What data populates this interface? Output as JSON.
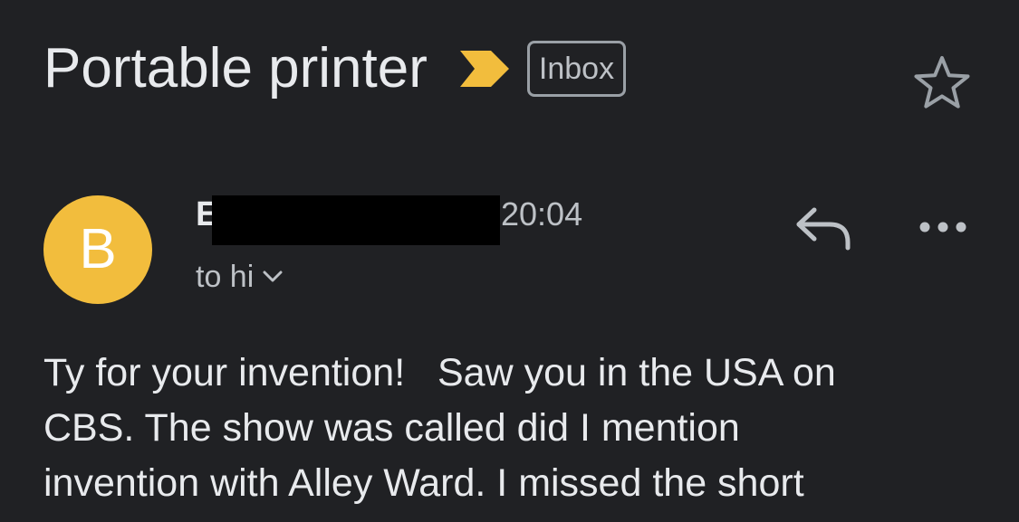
{
  "email": {
    "subject": "Portable printer",
    "label": "Inbox",
    "avatar_letter": "B",
    "sender_initial": "E",
    "time": "20:04",
    "recipient": "to hi",
    "body_lines": [
      "Ty for your invention!   Saw you in the USA on",
      "CBS. The show was called did I mention",
      "invention with Alley Ward. I missed the short"
    ]
  },
  "colors": {
    "background": "#202124",
    "avatar": "#f2bd3d",
    "importance_marker": "#f2bd3d",
    "primary_text": "#e8eaed",
    "secondary_text": "#bdc1c6"
  },
  "icons": {
    "importance": "importance-marker-icon",
    "star": "star-outline-icon",
    "recipient_expand": "chevron-down-icon",
    "reply": "reply-icon",
    "more": "more-horizontal-icon"
  }
}
